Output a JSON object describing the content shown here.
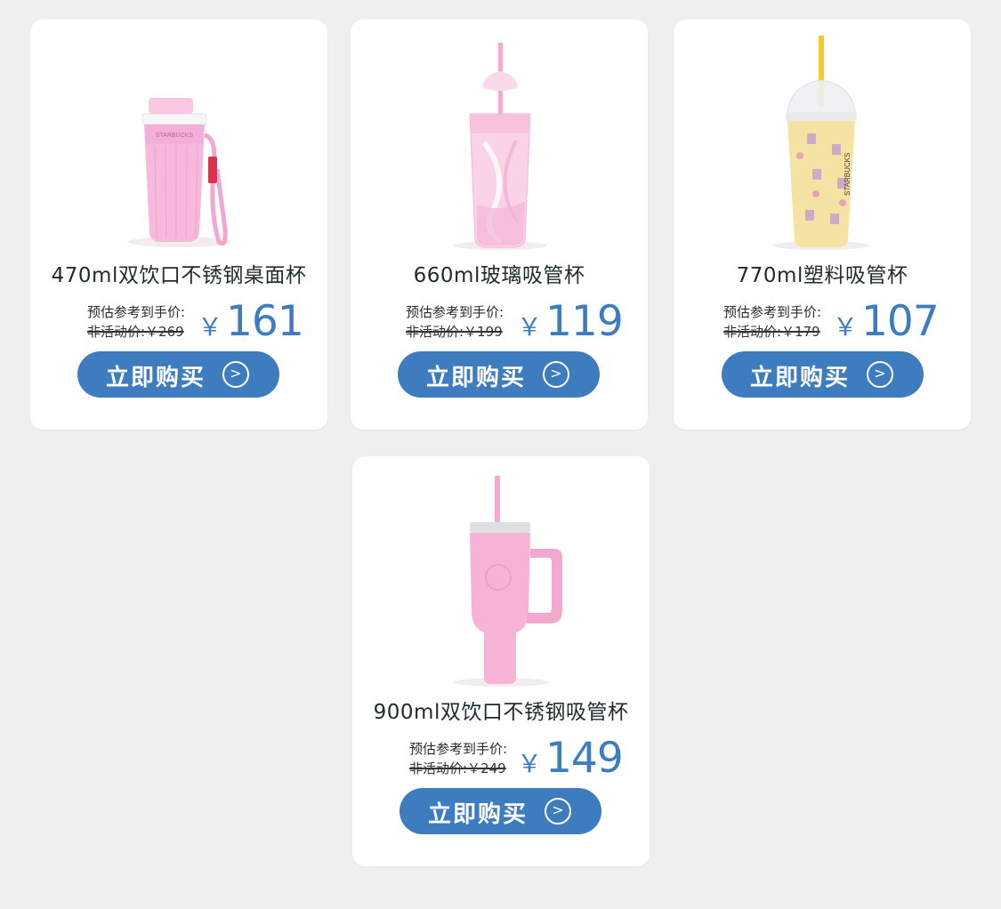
{
  "products": [
    {
      "title": "470ml双饮口不锈钢桌面杯",
      "est_label": "预估参考到手价:",
      "orig_label": "非活动价:￥269",
      "currency": "￥",
      "price": "161",
      "buy_label": "立即购买",
      "arrow": ">",
      "image_icon": "pink-tumbler-with-strap"
    },
    {
      "title": "660ml玻璃吸管杯",
      "est_label": "预估参考到手价:",
      "orig_label": "非活动价:￥199",
      "currency": "￥",
      "price": "119",
      "buy_label": "立即购买",
      "arrow": ">",
      "image_icon": "pink-glass-straw-cup"
    },
    {
      "title": "770ml塑料吸管杯",
      "est_label": "预估参考到手价:",
      "orig_label": "非活动价:￥179",
      "currency": "￥",
      "price": "107",
      "buy_label": "立即购买",
      "arrow": ">",
      "image_icon": "yellow-dome-straw-cup"
    },
    {
      "title": "900ml双饮口不锈钢吸管杯",
      "est_label": "预估参考到手价:",
      "orig_label": "非活动价:￥249",
      "currency": "￥",
      "price": "149",
      "buy_label": "立即购买",
      "arrow": ">",
      "image_icon": "pink-handle-straw-mug"
    }
  ],
  "colors": {
    "background": "#efefef",
    "card": "#ffffff",
    "accent": "#3d7cbe",
    "price": "#3d7cc0"
  }
}
